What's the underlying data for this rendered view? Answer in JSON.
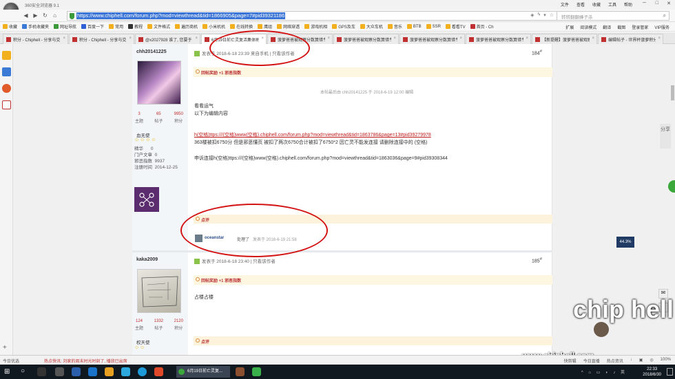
{
  "window": {
    "title": "360安全浏览器 9.1",
    "menu": [
      "文件",
      "查看",
      "收藏",
      "工具",
      "帮助"
    ],
    "controls": [
      "─",
      "□",
      "✕"
    ]
  },
  "address": {
    "url": "https://www.chiphell.com/forum.php?mod=viewthread&tid=1866905&page=7#pid39321186",
    "search_placeholder": "转转翻翻蜂子杀"
  },
  "bookmarks": [
    {
      "label": "收藏",
      "color": "#f2b01e"
    },
    {
      "label": "手机收藏夹",
      "color": "#3b7bd6"
    },
    {
      "label": "网址导航",
      "color": "#3b9b3b"
    },
    {
      "label": "百度一下",
      "color": "#2e60d6"
    },
    {
      "label": "常用",
      "color": "#f2b01e"
    },
    {
      "label": "教程",
      "color": "#333333"
    },
    {
      "label": "文件格式",
      "color": "#f2b01e"
    },
    {
      "label": "遍历商机",
      "color": "#f2b01e"
    },
    {
      "label": "小米机机",
      "color": "#f2b01e"
    },
    {
      "label": "在线转换",
      "color": "#f2b01e"
    },
    {
      "label": "鹰组",
      "color": "#f2b01e"
    },
    {
      "label": "网络穿透",
      "color": "#f2b01e"
    },
    {
      "label": "游戏机相",
      "color": "#f2b01e"
    },
    {
      "label": "GPS及车",
      "color": "#f2b01e"
    },
    {
      "label": "大众车机",
      "color": "#f2b01e"
    },
    {
      "label": "音乐",
      "color": "#f2b01e"
    },
    {
      "label": "BTB",
      "color": "#f2b01e"
    },
    {
      "label": "SSR",
      "color": "#f2b01e"
    },
    {
      "label": "看看TV",
      "color": "#f2b01e"
    },
    {
      "label": "首页 - Ch",
      "color": "#c03030"
    }
  ],
  "bookmarks_right": [
    "扩展",
    "阅读模式",
    "翻译",
    "截图",
    "登录管家",
    "VIP服务"
  ],
  "tabs": [
    {
      "label": "积分 - Chiphell - 分享与交"
    },
    {
      "label": "积分 - Chiphell - 分享与交"
    },
    {
      "label": "@x2027928 谁了, 您要于"
    },
    {
      "label": "6月19日前亡灵复活集体刷"
    },
    {
      "label": "菠萝爸爸被观察分数算错专"
    },
    {
      "label": "菠萝爸爸被观察分数算错专"
    },
    {
      "label": "菠萝爸爸被观察分数算错专"
    },
    {
      "label": "菠萝爸爸被观察分数算错专"
    },
    {
      "label": "【新提醒】菠萝爸爸被观察"
    },
    {
      "label": "编辑帖子 - 世界杯菠萝积分"
    }
  ],
  "post1": {
    "username": "chh20141225",
    "posts": "3",
    "posts_label": "主题",
    "threads": "65",
    "threads_label": "帖子",
    "points": "9950",
    "points_label": "积分",
    "group": "血无使",
    "stars": "☺☺☺☺",
    "info": "精华      0\n门户文章  0\n邪恶指数  9937\n注册时间  2014-12-25",
    "post_meta": "发表于 2018-6-18 23:39 来自手机 | 只看该作者",
    "floor": "184",
    "bonus": "回帖奖励 +1 邪恶指数",
    "edited": "本帖最后由 chh20141225 于 2018-6-19 12:00 编辑",
    "line1": "看看运气",
    "line2": "以下为编辑内容",
    "link_text": "h(空格)ttps:///(空格)www(空格).chiphell.com/forum.php?mod=viewthread&tid=1863786&page=13#pid39279978",
    "line4": "363楼被扣6750分 但是邪恶懂页 被扣了两次6750合计被扣了6750*2 因亡灵不能发连接 请删除连接中的 (空格)",
    "line5": "申诉连接h(空格)ttps:///(空格)www(空格).chiphell.com/forum.php?mod=viewthread&tid=1863036&page=9#pid39308344",
    "comment_label": "点评",
    "comment_user": "oceanstar",
    "comment_text": "处理了",
    "comment_time": "发表于 2018-6-19 21:58"
  },
  "post2": {
    "username": "kaka2009",
    "posts": "124",
    "posts_label": "主题",
    "threads": "1332",
    "threads_label": "帖子",
    "points": "2120",
    "points_label": "积分",
    "group": "权天使",
    "stars": "☺☺",
    "post_meta": "发表于 2018-6-18 23:40 | 只看该作者",
    "floor": "185",
    "bonus": "回帖奖励 +1 邪恶指数",
    "text": "占楼占楼",
    "comment_label": "点评"
  },
  "rightbar": {
    "label": "分享"
  },
  "zoom_overlay": "44.3%",
  "status": {
    "left": "今日优选",
    "news": "热点快讯: 刘家的周末时光时刻了, 播放已出席",
    "right": [
      "快剪辑",
      "今日直播",
      "热点资讯",
      "↓",
      "▣",
      "◎",
      "100%"
    ]
  },
  "taskbar": {
    "active_label": "6月19日前亡灵复...",
    "time": "22:33",
    "date": "2018/6/30"
  },
  "watermark": {
    "site": "www.chiphell.com",
    "brand": "chip hell"
  },
  "colors": {
    "accent": "#c03030",
    "ring": "#d31313",
    "link": "#c01b1b"
  }
}
